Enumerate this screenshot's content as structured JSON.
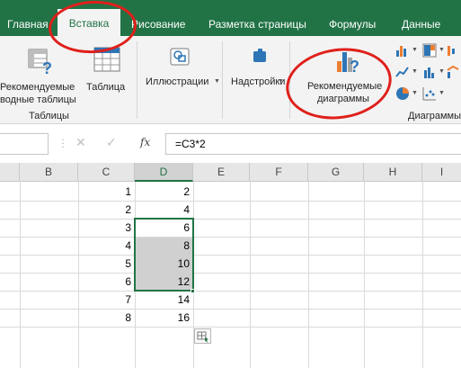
{
  "tabs": {
    "home": "Главная",
    "insert": "Вставка",
    "draw": "Рисование",
    "page_layout": "Разметка страницы",
    "formulas": "Формулы",
    "data": "Данные"
  },
  "ribbon": {
    "recommended_pivot_line1": "Рекомендуемые",
    "recommended_pivot_line2": "водные таблицы",
    "table": "Таблица",
    "tables_group": "Таблицы",
    "illustrations": "Иллюстрации",
    "addins": "Надстройки",
    "recommended_charts_line1": "Рекомендуемые",
    "recommended_charts_line2": "диаграммы",
    "charts_group": "Диаграммы"
  },
  "formula_bar": {
    "fx": "fx",
    "formula": "=C3*2",
    "cancel": "✕",
    "enter": "✓"
  },
  "grid": {
    "columns": [
      "B",
      "C",
      "D",
      "E",
      "F",
      "G",
      "H",
      "I"
    ],
    "selected_column": "D",
    "column_c_values": [
      "1",
      "2",
      "3",
      "4",
      "5",
      "6",
      "7",
      "8"
    ],
    "column_d_values": [
      "2",
      "4",
      "6",
      "8",
      "10",
      "12",
      "14",
      "16"
    ]
  },
  "colors": {
    "accent": "#217346",
    "annotation": "#e0201b",
    "selection_fill": "#d0d0d0"
  }
}
